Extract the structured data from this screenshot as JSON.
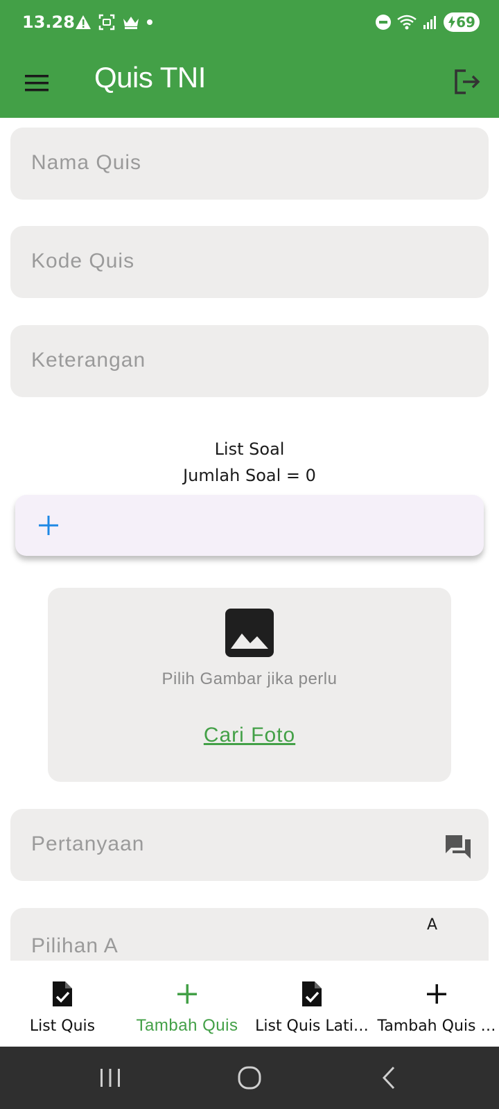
{
  "status_bar": {
    "time": "13.28",
    "battery": "69"
  },
  "app_bar": {
    "title": "Quis TNI"
  },
  "form": {
    "nama_quis_placeholder": "Nama Quis",
    "kode_quis_placeholder": "Kode Quis",
    "keterangan_placeholder": "Keterangan",
    "pertanyaan_placeholder": "Pertanyaan",
    "pilihan_a_placeholder": "Pilihan A",
    "pilihan_a_marker": "A"
  },
  "soal": {
    "heading": "List Soal",
    "count_label": "Jumlah Soal = 0"
  },
  "image_picker": {
    "hint": "Pilih Gambar jika perlu",
    "link": "Cari Foto"
  },
  "bottom_nav": {
    "items": [
      {
        "label": "List Quis",
        "icon": "document-check-icon"
      },
      {
        "label": "Tambah Quis",
        "icon": "plus-icon"
      },
      {
        "label": "List Quis Lati…",
        "icon": "document-check-icon"
      },
      {
        "label": "Tambah Quis …",
        "icon": "plus-icon"
      }
    ]
  },
  "colors": {
    "primary": "#43a047",
    "field_bg": "#eeedec",
    "add_card_bg": "#f5f0f9",
    "plus_blue": "#1e88e5"
  }
}
